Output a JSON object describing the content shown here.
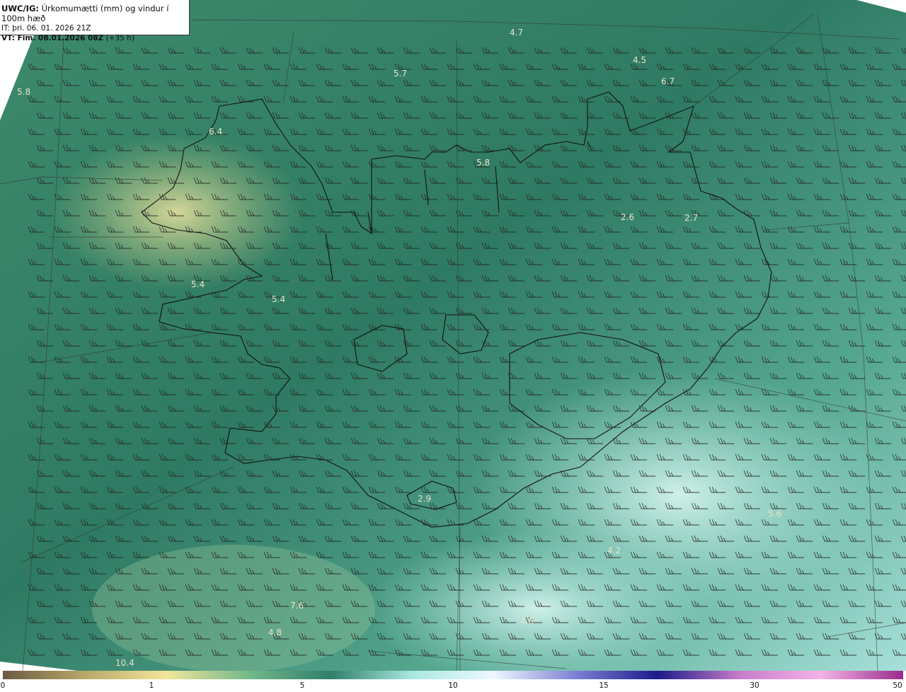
{
  "header": {
    "product": "UWC/IG:",
    "description": "Úrkomumætti (mm) og vindur í 100m hæð",
    "initial_time": "IT: þri. 06. 01. 2026 21Z",
    "valid_label": "VT: Fim. 08.01.2026 08Z",
    "valid_offset": "(+35 h)"
  },
  "colors": {
    "sea_dark": "#2e7a62",
    "land_mid": "#9fbe7a",
    "land_high": "#e6dc96",
    "sea_light": "#b9eae2"
  },
  "legend": {
    "ticks": [
      "0",
      "1",
      "5",
      "10",
      "15",
      "30",
      "50"
    ],
    "stops": [
      "#6b5a43",
      "#b8a868",
      "#f2e69a",
      "#74b98a",
      "#2f7f6a",
      "#a9e8e2",
      "#eef8ff",
      "#7d7fd4",
      "#1d1a8a",
      "#c77bc9",
      "#f4b3e6",
      "#9a2a8c"
    ]
  },
  "labels": [
    {
      "text": "4.7"
    },
    {
      "text": "4.5"
    },
    {
      "text": "6.7"
    },
    {
      "text": "5.7"
    },
    {
      "text": "5.8"
    },
    {
      "text": "6.4"
    },
    {
      "text": "5.8"
    },
    {
      "text": "2.6"
    },
    {
      "text": "2.7"
    },
    {
      "text": "5.4"
    },
    {
      "text": "5.4"
    },
    {
      "text": "5.6"
    },
    {
      "text": "4.2"
    },
    {
      "text": "7.6"
    },
    {
      "text": "4.6"
    },
    {
      "text": "4.8"
    },
    {
      "text": "10.4"
    },
    {
      "text": "2.9"
    }
  ]
}
